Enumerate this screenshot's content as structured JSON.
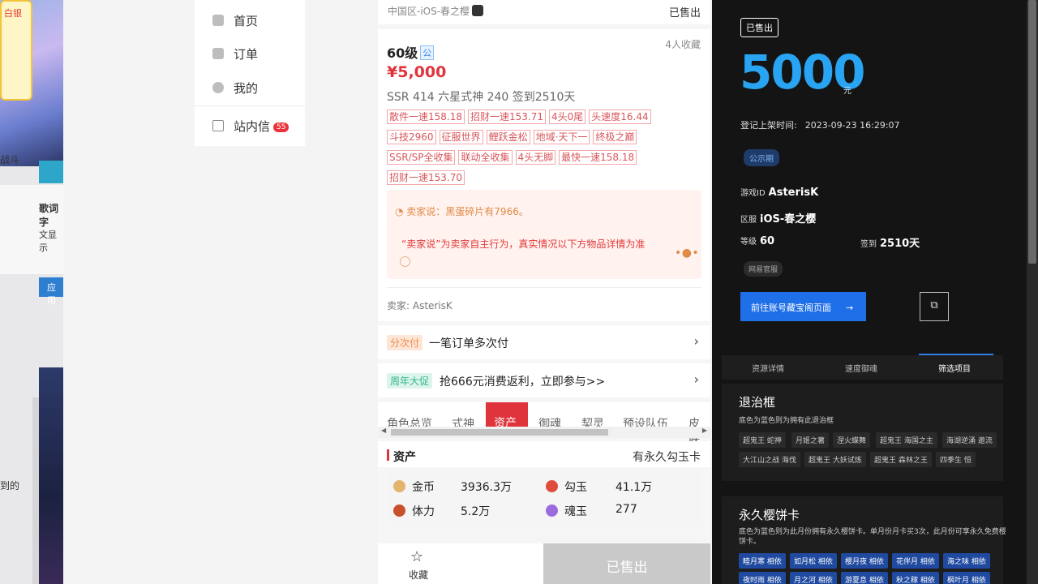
{
  "left_strip": {
    "badge": "白银",
    "label1": "战斗",
    "label2": "歌词字",
    "label3": "文显示",
    "tab": "应用",
    "label4": "到的"
  },
  "nav": {
    "home": "首页",
    "orders": "订单",
    "mine": "我的",
    "messages": "站内信",
    "messages_count": "55"
  },
  "product": {
    "server": "中国区-iOS-春之樱",
    "status_top": "已售出",
    "level": "60级",
    "public_badge": "公",
    "favorites": "4人收藏",
    "price": "¥5,000",
    "summary": "SSR 414   六星式神 240   签到2510天",
    "tags": [
      "散件一速158.18",
      "招财一速153.71",
      "4头0尾",
      "头速度16.44",
      "斗技2960",
      "征服世界",
      "鲤跃金松",
      "地域·天下一",
      "终极之巅",
      "SSR/SP全收集",
      "联动全收集",
      "4头无脚",
      "最快一速158.18",
      "招财一速153.70"
    ],
    "seller_says": "卖家说：黑蛋碎片有7966。",
    "seller_warning": "“卖家说”为卖家自主行为，真实情况以下方物品详情为准",
    "seller_name": "卖家: AsterisK",
    "installment_badge": "分次付",
    "installment_text": "一笔订单多次付",
    "promo_badge": "周年大促",
    "promo_text": "抢666元消费返利，立即参与>>",
    "tabs": [
      "角色总览",
      "式神",
      "资产",
      "御魂",
      "契灵",
      "预设队伍",
      "皮肤"
    ],
    "assets_title": "资产",
    "assets_note": "有永久勾玉卡",
    "assets": [
      {
        "name": "金币",
        "value": "3936.3万"
      },
      {
        "name": "勾玉",
        "value": "41.1万"
      },
      {
        "name": "体力",
        "value": "5.2万"
      },
      {
        "name": "魂玉",
        "value": "277"
      }
    ],
    "favorite_label": "收藏",
    "sold_button": "已售出"
  },
  "dark": {
    "sold_badge": "已售出",
    "price": "5000",
    "unit": "元",
    "listed_label": "登记上架时间:",
    "listed_value": "2023-09-23 16:29:07",
    "public_badge": "公示期",
    "game_id_label": "游戏ID",
    "game_id": "AsterisK",
    "server_label": "区服",
    "server": "iOS-春之樱",
    "level_label": "等级",
    "level": "60",
    "checkin_label": "签到",
    "checkin": "2510天",
    "official_badge": "网易官服",
    "goto_button": "前往账号藏宝阁页面",
    "goto_arrow": "→",
    "copy_icon": "⧉",
    "tabs": [
      "资源详情",
      "速度御魂",
      "筛选项目"
    ],
    "frame_title": "退治框",
    "frame_desc": "底色为蓝色则为拥有此退治框",
    "frame_chips": [
      "超鬼王 蛇神",
      "月姬之薯",
      "涅火蝶舞",
      "超鬼王 海国之主",
      "海湖逆涌 邀流",
      "大江山之战 海伐",
      "超鬼王 大妖试炼",
      "超鬼王 森林之王",
      "四季生 恒"
    ],
    "card_title": "永久樱饼卡",
    "card_desc": "底色为蓝色则为此月份拥有永久樱饼卡。单月份月卡买3次，此月份可享永久免费樱饼卡。",
    "card_chips": [
      "睦月寒 相依",
      "如月松 相依",
      "樱月夜 相依",
      "花伴月 相依",
      "海之味 相依",
      "夜时雨 相依",
      "月之河 相依",
      "游夏息 相依",
      "秋之稼 相依",
      "枫叶月 相依"
    ]
  }
}
